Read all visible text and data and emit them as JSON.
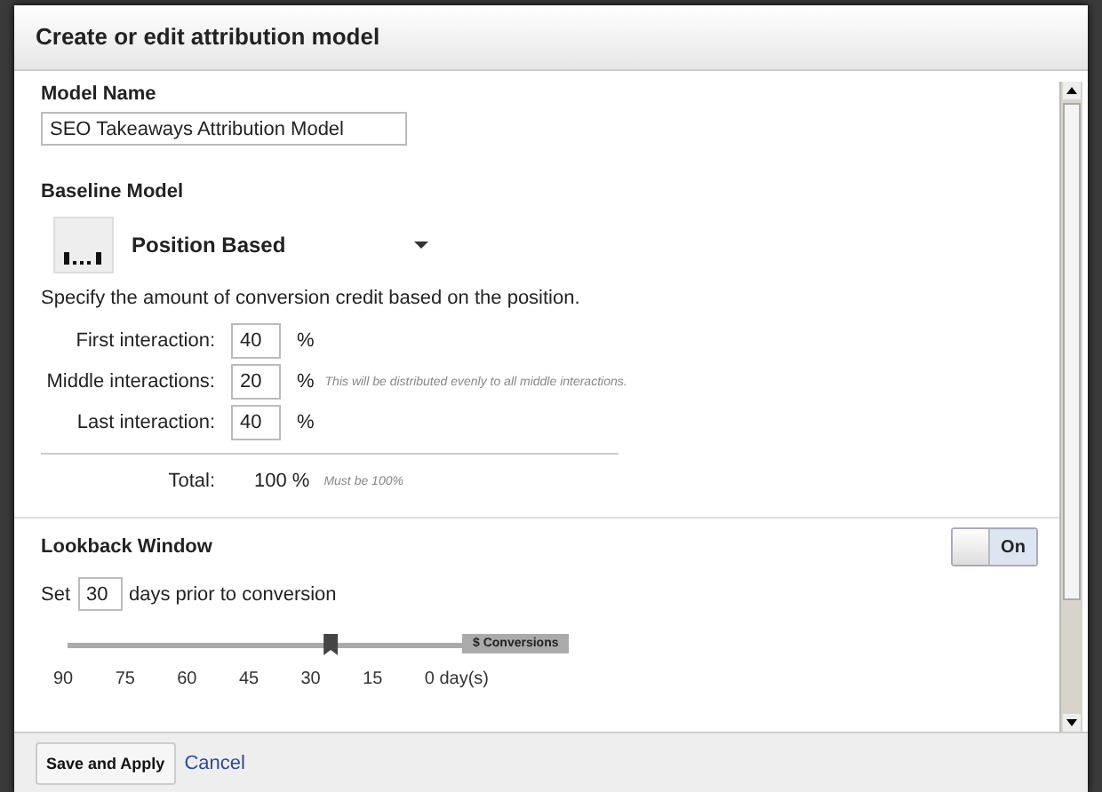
{
  "dialog": {
    "title": "Create or edit attribution model"
  },
  "model_name": {
    "label": "Model Name",
    "value": "SEO Takeaways Attribution Model"
  },
  "baseline": {
    "label": "Baseline Model",
    "selected_model": "Position Based",
    "description": "Specify the amount of conversion credit based on the position.",
    "interactions": [
      {
        "label": "First interaction:",
        "value": "40",
        "unit": "%"
      },
      {
        "label": "Middle interactions:",
        "value": "20",
        "unit": "%",
        "note": "This will be distributed evenly to all middle interactions."
      },
      {
        "label": "Last interaction:",
        "value": "40",
        "unit": "%"
      }
    ],
    "total": {
      "label": "Total:",
      "value": "100 %",
      "note": "Must be 100%"
    }
  },
  "lookback": {
    "label": "Lookback Window",
    "toggle": {
      "label": "On",
      "on": true
    },
    "prefix": "Set",
    "days": "30",
    "suffix": "days prior to conversion",
    "slider": {
      "level": 0.667,
      "marker": "$ Conversions",
      "ticks": [
        "90",
        "75",
        "60",
        "45",
        "30",
        "15",
        "0 day(s)"
      ]
    }
  },
  "footer": {
    "buttons": [
      {
        "label": "Save and Apply",
        "kind": "primary"
      },
      {
        "label": "Cancel",
        "kind": "link"
      }
    ]
  }
}
